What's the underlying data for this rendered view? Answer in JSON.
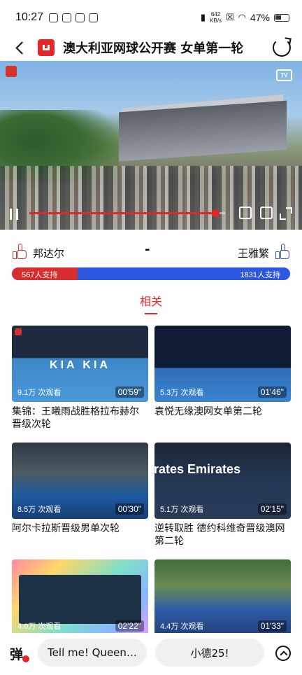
{
  "status": {
    "time": "10:27",
    "net_speed": "642",
    "net_unit": "KB/s",
    "battery": "47%"
  },
  "header": {
    "title": "澳大利亚网球公开赛 女单第一轮"
  },
  "player": {
    "tv_label": "TV",
    "progress": 0.95
  },
  "vote": {
    "left_name": "邦达尔",
    "right_name": "王雅繁",
    "separator": "-",
    "left_support": "567人支持",
    "right_support": "1831人支持",
    "left_count": 567,
    "right_count": 1831,
    "left_color": "#d82e2e",
    "right_color": "#2c57e0"
  },
  "related": {
    "label": "相关"
  },
  "cards": [
    {
      "views": "9.1万 次观看",
      "duration": "00'59\"",
      "title": "集锦：王曦雨战胜格拉布赫尔晋级次轮",
      "watermark": "KIA  KIA"
    },
    {
      "views": "5.3万 次观看",
      "duration": "01'46\"",
      "title": "袁悦无缘澳网女单第二轮",
      "watermark": ""
    },
    {
      "views": "8.5万 次观看",
      "duration": "00'30\"",
      "title": "阿尔卡拉斯晋级男单次轮",
      "watermark": ""
    },
    {
      "views": "5.1万 次观看",
      "duration": "02'15\"",
      "title": "逆转取胜 德约科维奇晋级澳网第二轮",
      "watermark": "irates  Emirates"
    },
    {
      "views": "4.0万 次观看",
      "duration": "02'22\"",
      "title": "",
      "watermark": ""
    },
    {
      "views": "4.4万 次观看",
      "duration": "01'33\"",
      "title": "",
      "watermark": ""
    }
  ],
  "bottom": {
    "danmu_icon": "弹",
    "chip1": "Tell me! Queen…",
    "chip2": "小德25!"
  }
}
